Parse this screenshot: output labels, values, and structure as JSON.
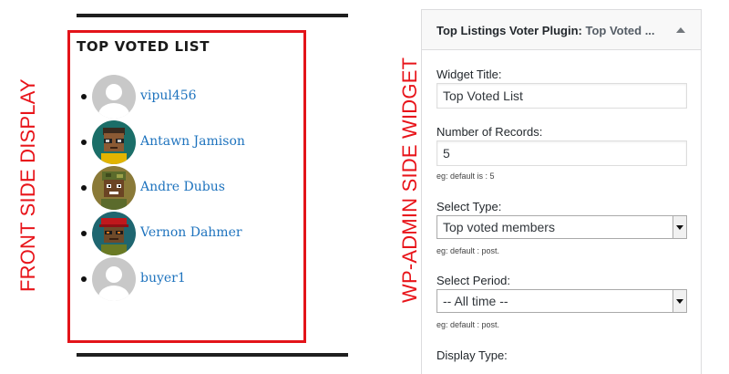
{
  "annotations": {
    "front_label": "FRONT SIDE DISPLAY",
    "admin_label": "WP-ADMIN SIDE WIDGET",
    "highlight_color": "#e3141a"
  },
  "front": {
    "title": "TOP VOTED LIST",
    "members": [
      {
        "name": "vipul456",
        "avatar": "default-avatar"
      },
      {
        "name": "Antawn Jamison",
        "avatar": "pixel-avatar-glasses"
      },
      {
        "name": "Andre Dubus",
        "avatar": "pixel-avatar-camo"
      },
      {
        "name": "Vernon Dahmer",
        "avatar": "pixel-avatar-red-hat"
      },
      {
        "name": "buyer1",
        "avatar": "default-avatar"
      }
    ],
    "link_color": "#1e73be"
  },
  "widget": {
    "header_title": "Top Listings Voter Plugin:",
    "header_subtitle": "Top Voted ...",
    "fields": {
      "title_label": "Widget Title:",
      "title_value": "Top Voted List",
      "records_label": "Number of Records:",
      "records_value": "5",
      "records_hint": "eg: default is : 5",
      "type_label": "Select Type:",
      "type_value": "Top voted members",
      "type_hint": "eg: default : post.",
      "period_label": "Select Period:",
      "period_value": "-- All time --",
      "period_hint": "eg: default : post.",
      "display_label": "Display Type:"
    }
  }
}
